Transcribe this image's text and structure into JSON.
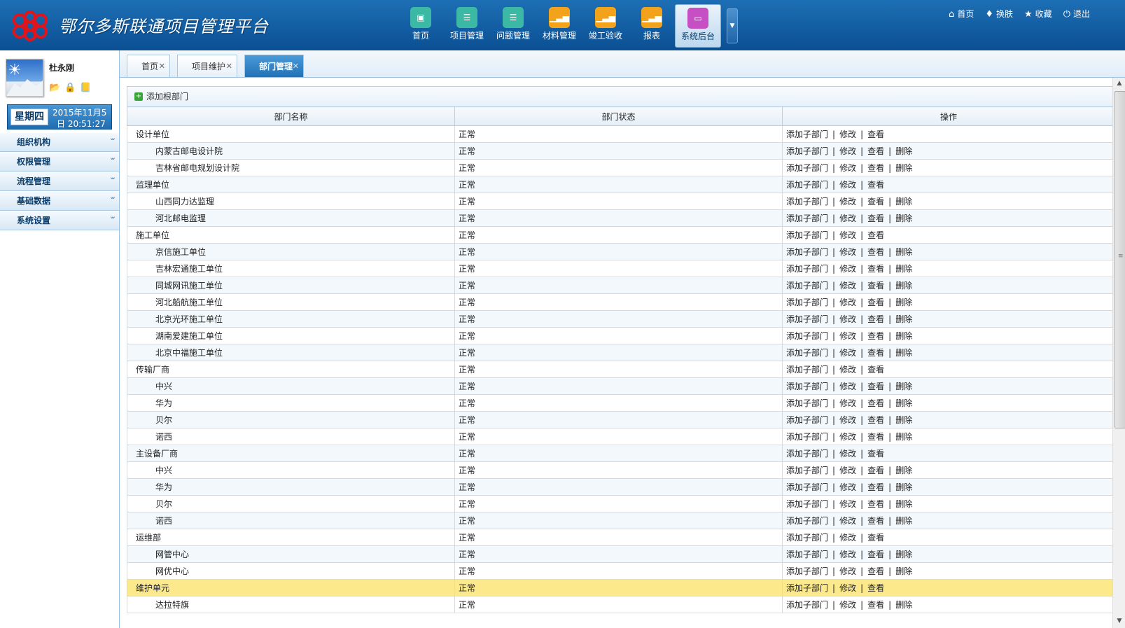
{
  "app": {
    "title": "鄂尔多斯联通项目管理平台",
    "logo_icon": "china-unicom-knot-icon",
    "brand_color": "#0b4f93"
  },
  "topnav": [
    {
      "label": "首页",
      "icon": "home-briefcase-icon",
      "color": "#3cb9a5"
    },
    {
      "label": "项目管理",
      "icon": "document-list-icon",
      "color": "#3cb9a5"
    },
    {
      "label": "问题管理",
      "icon": "document-list-icon",
      "color": "#3cb9a5"
    },
    {
      "label": "材料管理",
      "icon": "bar-chart-icon",
      "color": "#f2a21b"
    },
    {
      "label": "竣工验收",
      "icon": "bar-chart-icon",
      "color": "#f2a21b"
    },
    {
      "label": "报表",
      "icon": "bar-chart-icon",
      "color": "#f2a21b"
    },
    {
      "label": "系统后台",
      "icon": "monitor-icon",
      "color": "#c74fc4",
      "active": true
    }
  ],
  "toplinks": [
    {
      "label": "首页",
      "icon": "home-icon"
    },
    {
      "label": "换肤",
      "icon": "shirt-icon"
    },
    {
      "label": "收藏",
      "icon": "star-icon"
    },
    {
      "label": "退出",
      "icon": "power-icon"
    }
  ],
  "user": {
    "name": "杜永刚",
    "weekday": "星期四",
    "date_line1": "2015年11月5",
    "date_line2": "日 20:51:27"
  },
  "sidebar_menu": [
    "组织机构",
    "权限管理",
    "流程管理",
    "基础数据",
    "系统设置"
  ],
  "tabs": [
    "首页",
    "项目维护",
    "部门管理"
  ],
  "active_tab": "部门管理",
  "toolbar": {
    "add_root": "添加根部门"
  },
  "table": {
    "columns": [
      "部门名称",
      "部门状态",
      "操作"
    ],
    "actions": {
      "add_child": "添加子部门",
      "edit": "修改",
      "view": "查看",
      "delete": "删除",
      "separator": "|"
    },
    "rows": [
      {
        "name": "设计单位",
        "status": "正常",
        "level": 0
      },
      {
        "name": "内蒙古邮电设计院",
        "status": "正常",
        "level": 1
      },
      {
        "name": "吉林省邮电规划设计院",
        "status": "正常",
        "level": 1
      },
      {
        "name": "监理单位",
        "status": "正常",
        "level": 0
      },
      {
        "name": "山西同力达监理",
        "status": "正常",
        "level": 1
      },
      {
        "name": "河北邮电监理",
        "status": "正常",
        "level": 1
      },
      {
        "name": "施工单位",
        "status": "正常",
        "level": 0
      },
      {
        "name": "京信施工单位",
        "status": "正常",
        "level": 1
      },
      {
        "name": "吉林宏通施工单位",
        "status": "正常",
        "level": 1
      },
      {
        "name": "同城网讯施工单位",
        "status": "正常",
        "level": 1
      },
      {
        "name": "河北船航施工单位",
        "status": "正常",
        "level": 1
      },
      {
        "name": "北京光环施工单位",
        "status": "正常",
        "level": 1
      },
      {
        "name": "湖南爱建施工单位",
        "status": "正常",
        "level": 1
      },
      {
        "name": "北京中福施工单位",
        "status": "正常",
        "level": 1
      },
      {
        "name": "传输厂商",
        "status": "正常",
        "level": 0
      },
      {
        "name": "中兴",
        "status": "正常",
        "level": 1
      },
      {
        "name": "华为",
        "status": "正常",
        "level": 1
      },
      {
        "name": "贝尔",
        "status": "正常",
        "level": 1
      },
      {
        "name": "诺西",
        "status": "正常",
        "level": 1
      },
      {
        "name": "主设备厂商",
        "status": "正常",
        "level": 0
      },
      {
        "name": "中兴",
        "status": "正常",
        "level": 1
      },
      {
        "name": "华为",
        "status": "正常",
        "level": 1
      },
      {
        "name": "贝尔",
        "status": "正常",
        "level": 1
      },
      {
        "name": "诺西",
        "status": "正常",
        "level": 1
      },
      {
        "name": "运维部",
        "status": "正常",
        "level": 0
      },
      {
        "name": "网管中心",
        "status": "正常",
        "level": 1
      },
      {
        "name": "网优中心",
        "status": "正常",
        "level": 1
      },
      {
        "name": "维护单元",
        "status": "正常",
        "level": 0,
        "highlighted": true
      },
      {
        "name": "达拉特旗",
        "status": "正常",
        "level": 1
      }
    ]
  }
}
